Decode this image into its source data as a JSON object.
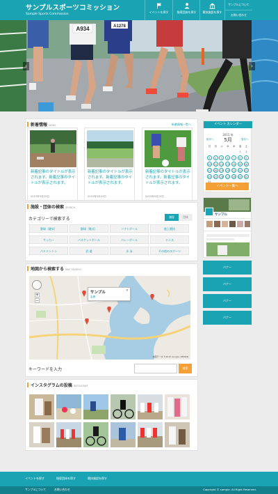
{
  "header": {
    "site_title": "サンプルスポーツコミッション",
    "site_subtitle": "Sample Sports Commission",
    "nav": [
      {
        "label": "イベントを探す",
        "icon": "flag-icon"
      },
      {
        "label": "指導団体を探す",
        "icon": "person-icon"
      },
      {
        "label": "競技施設を探す",
        "icon": "building-icon"
      }
    ],
    "subnav": [
      "サンプルについて",
      "お問い合わせ"
    ]
  },
  "hero": {
    "bib_1": "A934",
    "bib_2": "A1278"
  },
  "news": {
    "heading": "新着情報",
    "heading_en": "NEWS",
    "more_link": "新着情報一覧へ",
    "items": [
      {
        "text": "新着記事のタイトルが表示されます。新着記事のタイトルが表示されます。",
        "date": "2015年5月25日"
      },
      {
        "text": "新着記事のタイトルが表示されます。新着記事のタイトルが表示されます。",
        "date": "2015年5月24日"
      },
      {
        "text": "新着記事のタイトルが表示されます。新着記事のタイトルが表示されます。",
        "date": "2015年5月23日"
      }
    ]
  },
  "facility": {
    "heading": "施設・団体の検索",
    "heading_en": "SEARCH",
    "category_label": "カテゴリーで検索する",
    "tabs": [
      "施設",
      "団体"
    ],
    "categories": [
      "野球（硬式）",
      "野球（軟式）",
      "ソフトボール",
      "陸上競技",
      "サッカー",
      "バスケットボール",
      "バレーボール",
      "テニス",
      "バドミントン",
      "武 道",
      "水 泳",
      "その他のスポーツ"
    ]
  },
  "map": {
    "heading": "地図から検索する",
    "heading_en": "MAP SEARCH",
    "popup_title": "サンプル",
    "popup_sub": "会場",
    "popup_close": "×",
    "zoom_in": "+",
    "zoom_out": "−",
    "credit": "地図データ ©2015 Google, ZENRIN"
  },
  "keyword": {
    "label": "キーワードを入力",
    "placeholder": "",
    "button": "検索"
  },
  "instagram": {
    "heading": "インスタグラムの投稿",
    "heading_en": "INSTAGRAM"
  },
  "calendar": {
    "title": "イベント カレンダー",
    "year": "2015 年",
    "month": "5月",
    "prev": "前月へ",
    "next": "翌月へ",
    "days": [
      "日",
      "月",
      "火",
      "水",
      "木",
      "金",
      "土"
    ],
    "weeks": [
      [
        "",
        "",
        "",
        "",
        "",
        "1",
        "2"
      ],
      [
        "3",
        "4",
        "5",
        "6",
        "7",
        "8",
        "9"
      ],
      [
        "10",
        "11",
        "12",
        "13",
        "14",
        "15",
        "16"
      ],
      [
        "17",
        "18",
        "19",
        "20",
        "21",
        "22",
        "23"
      ],
      [
        "24",
        "25",
        "26",
        "27",
        "28",
        "29",
        "30"
      ],
      [
        "31",
        "",
        "",
        "",
        "",
        "",
        ""
      ]
    ],
    "button": "イベント一覧へ"
  },
  "social": {
    "page_name": "サンプル"
  },
  "banners": [
    "バナー",
    "バナー",
    "バナー",
    "バナー"
  ],
  "footer": {
    "nav": [
      "イベントを探す",
      "指導団体を探す",
      "競技施設を探す"
    ],
    "bottom_links": [
      "サンプルについて",
      "お問い合わせ"
    ],
    "copyright": "Copyright © sample. All Right Reserved."
  },
  "colors": {
    "primary": "#1aa3b3",
    "accent": "#f3a036",
    "dark": "#137e8c",
    "background": "#ececec"
  }
}
